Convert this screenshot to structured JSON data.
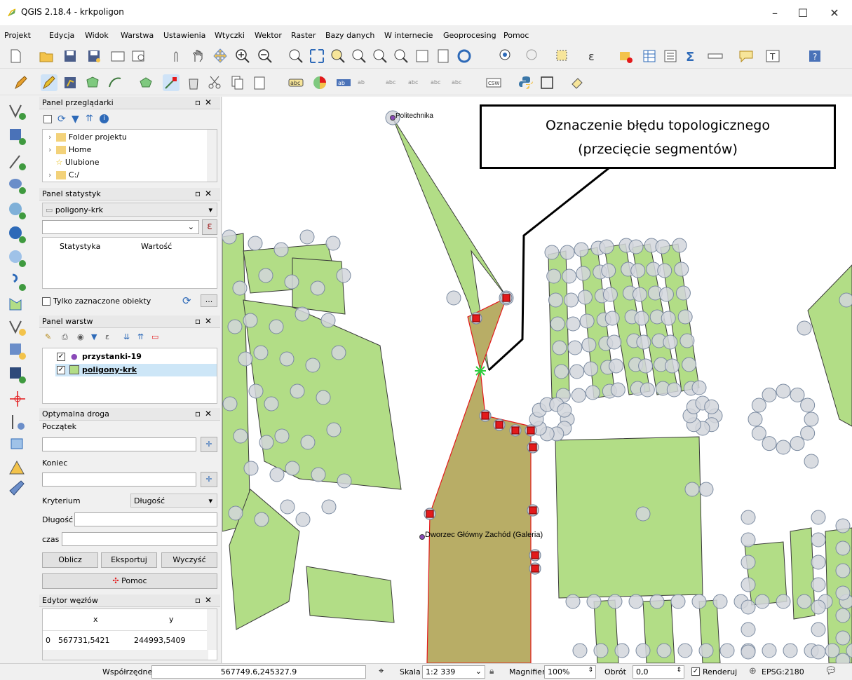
{
  "window": {
    "title": "QGIS 2.18.4 - krkpoligon",
    "minimize": "–",
    "maximize": "☐",
    "close": "✕"
  },
  "menu": [
    "Projekt",
    "Edycja",
    "Widok",
    "Warstwa",
    "Ustawienia",
    "Wtyczki",
    "Wektor",
    "Raster",
    "Bazy danych",
    "W internecie",
    "Geoprocesing",
    "Pomoc"
  ],
  "browser_panel": {
    "title": "Panel przeglądarki",
    "items": [
      "Folder projektu",
      "Home",
      "Ulubione",
      "C:/"
    ]
  },
  "stats_panel": {
    "title": "Panel statystyk",
    "layer": "poligony-krk",
    "col_stat": "Statystyka",
    "col_value": "Wartość",
    "only_selected": "Tylko zaznaczone obiekty",
    "expr_button": "ε",
    "more_button": "..."
  },
  "layers_panel": {
    "title": "Panel warstw",
    "layers": [
      "przystanki-19",
      "poligony-krk"
    ]
  },
  "route_panel": {
    "title": "Optymalna droga",
    "start_label": "Początek",
    "end_label": "Koniec",
    "criterion_label": "Kryterium",
    "criterion_value": "Długość",
    "length_label": "Długość",
    "time_label": "czas",
    "calc": "Oblicz",
    "export": "Eksportuj",
    "clear": "Wyczyść",
    "help": "Pomoc"
  },
  "node_editor": {
    "title": "Edytor węzłów",
    "col_x": "x",
    "col_y": "y",
    "row_index": "0",
    "row_x": "567731,5421",
    "row_y": "244993,5409"
  },
  "map": {
    "labels": [
      "Politechnika",
      "Dworzec Główny Zachód (Galeria)"
    ],
    "callout_line1": "Oznaczenie błędu topologicznego",
    "callout_line2": "(przecięcie segmentów)"
  },
  "status": {
    "coords_label": "Współrzędne",
    "coords": "567749.6,245327.9",
    "scale_label": "Skala",
    "scale": "1:2 339",
    "magnifier_label": "Magnifier",
    "magnifier": "100%",
    "rotation_label": "Obrót",
    "rotation": "0,0",
    "render": "Renderuj",
    "crs": "EPSG:2180"
  },
  "colors": {
    "polygon_fill": "#b2dd86",
    "vertex_circle": "#d2d6dc",
    "error_red": "#e31a1c",
    "selected_fill": "#b8ad66"
  }
}
